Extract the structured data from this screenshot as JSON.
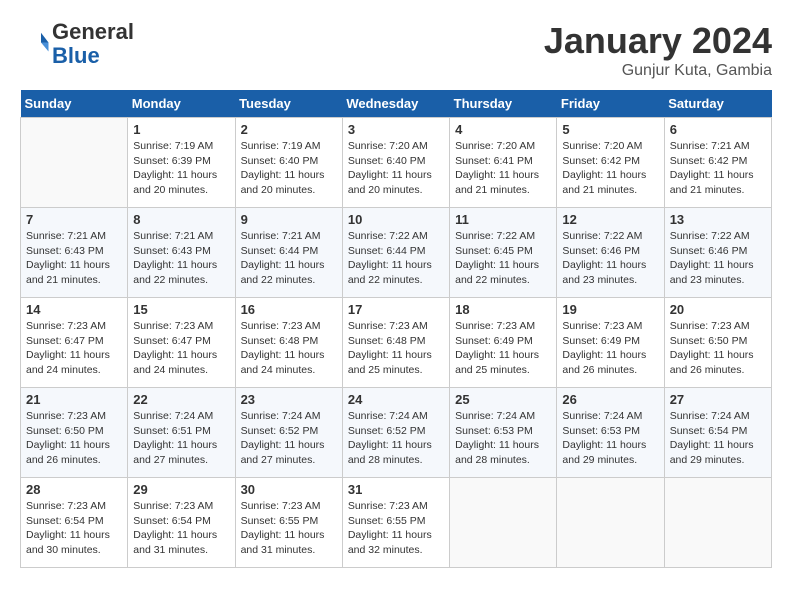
{
  "header": {
    "logo_line1": "General",
    "logo_line2": "Blue",
    "title": "January 2024",
    "subtitle": "Gunjur Kuta, Gambia"
  },
  "weekdays": [
    "Sunday",
    "Monday",
    "Tuesday",
    "Wednesday",
    "Thursday",
    "Friday",
    "Saturday"
  ],
  "weeks": [
    [
      {
        "day": "",
        "detail": ""
      },
      {
        "day": "1",
        "detail": "Sunrise: 7:19 AM\nSunset: 6:39 PM\nDaylight: 11 hours\nand 20 minutes."
      },
      {
        "day": "2",
        "detail": "Sunrise: 7:19 AM\nSunset: 6:40 PM\nDaylight: 11 hours\nand 20 minutes."
      },
      {
        "day": "3",
        "detail": "Sunrise: 7:20 AM\nSunset: 6:40 PM\nDaylight: 11 hours\nand 20 minutes."
      },
      {
        "day": "4",
        "detail": "Sunrise: 7:20 AM\nSunset: 6:41 PM\nDaylight: 11 hours\nand 21 minutes."
      },
      {
        "day": "5",
        "detail": "Sunrise: 7:20 AM\nSunset: 6:42 PM\nDaylight: 11 hours\nand 21 minutes."
      },
      {
        "day": "6",
        "detail": "Sunrise: 7:21 AM\nSunset: 6:42 PM\nDaylight: 11 hours\nand 21 minutes."
      }
    ],
    [
      {
        "day": "7",
        "detail": "Sunrise: 7:21 AM\nSunset: 6:43 PM\nDaylight: 11 hours\nand 21 minutes."
      },
      {
        "day": "8",
        "detail": "Sunrise: 7:21 AM\nSunset: 6:43 PM\nDaylight: 11 hours\nand 22 minutes."
      },
      {
        "day": "9",
        "detail": "Sunrise: 7:21 AM\nSunset: 6:44 PM\nDaylight: 11 hours\nand 22 minutes."
      },
      {
        "day": "10",
        "detail": "Sunrise: 7:22 AM\nSunset: 6:44 PM\nDaylight: 11 hours\nand 22 minutes."
      },
      {
        "day": "11",
        "detail": "Sunrise: 7:22 AM\nSunset: 6:45 PM\nDaylight: 11 hours\nand 22 minutes."
      },
      {
        "day": "12",
        "detail": "Sunrise: 7:22 AM\nSunset: 6:46 PM\nDaylight: 11 hours\nand 23 minutes."
      },
      {
        "day": "13",
        "detail": "Sunrise: 7:22 AM\nSunset: 6:46 PM\nDaylight: 11 hours\nand 23 minutes."
      }
    ],
    [
      {
        "day": "14",
        "detail": "Sunrise: 7:23 AM\nSunset: 6:47 PM\nDaylight: 11 hours\nand 24 minutes."
      },
      {
        "day": "15",
        "detail": "Sunrise: 7:23 AM\nSunset: 6:47 PM\nDaylight: 11 hours\nand 24 minutes."
      },
      {
        "day": "16",
        "detail": "Sunrise: 7:23 AM\nSunset: 6:48 PM\nDaylight: 11 hours\nand 24 minutes."
      },
      {
        "day": "17",
        "detail": "Sunrise: 7:23 AM\nSunset: 6:48 PM\nDaylight: 11 hours\nand 25 minutes."
      },
      {
        "day": "18",
        "detail": "Sunrise: 7:23 AM\nSunset: 6:49 PM\nDaylight: 11 hours\nand 25 minutes."
      },
      {
        "day": "19",
        "detail": "Sunrise: 7:23 AM\nSunset: 6:49 PM\nDaylight: 11 hours\nand 26 minutes."
      },
      {
        "day": "20",
        "detail": "Sunrise: 7:23 AM\nSunset: 6:50 PM\nDaylight: 11 hours\nand 26 minutes."
      }
    ],
    [
      {
        "day": "21",
        "detail": "Sunrise: 7:23 AM\nSunset: 6:50 PM\nDaylight: 11 hours\nand 26 minutes."
      },
      {
        "day": "22",
        "detail": "Sunrise: 7:24 AM\nSunset: 6:51 PM\nDaylight: 11 hours\nand 27 minutes."
      },
      {
        "day": "23",
        "detail": "Sunrise: 7:24 AM\nSunset: 6:52 PM\nDaylight: 11 hours\nand 27 minutes."
      },
      {
        "day": "24",
        "detail": "Sunrise: 7:24 AM\nSunset: 6:52 PM\nDaylight: 11 hours\nand 28 minutes."
      },
      {
        "day": "25",
        "detail": "Sunrise: 7:24 AM\nSunset: 6:53 PM\nDaylight: 11 hours\nand 28 minutes."
      },
      {
        "day": "26",
        "detail": "Sunrise: 7:24 AM\nSunset: 6:53 PM\nDaylight: 11 hours\nand 29 minutes."
      },
      {
        "day": "27",
        "detail": "Sunrise: 7:24 AM\nSunset: 6:54 PM\nDaylight: 11 hours\nand 29 minutes."
      }
    ],
    [
      {
        "day": "28",
        "detail": "Sunrise: 7:23 AM\nSunset: 6:54 PM\nDaylight: 11 hours\nand 30 minutes."
      },
      {
        "day": "29",
        "detail": "Sunrise: 7:23 AM\nSunset: 6:54 PM\nDaylight: 11 hours\nand 31 minutes."
      },
      {
        "day": "30",
        "detail": "Sunrise: 7:23 AM\nSunset: 6:55 PM\nDaylight: 11 hours\nand 31 minutes."
      },
      {
        "day": "31",
        "detail": "Sunrise: 7:23 AM\nSunset: 6:55 PM\nDaylight: 11 hours\nand 32 minutes."
      },
      {
        "day": "",
        "detail": ""
      },
      {
        "day": "",
        "detail": ""
      },
      {
        "day": "",
        "detail": ""
      }
    ]
  ]
}
